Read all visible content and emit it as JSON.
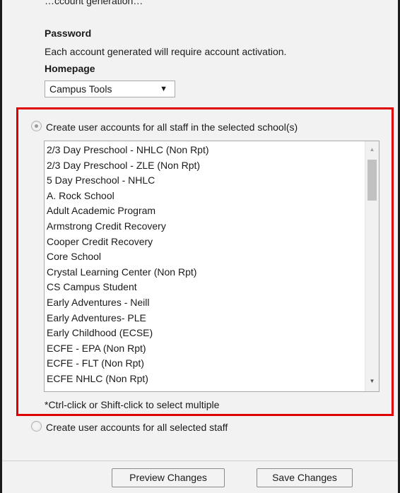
{
  "partial_top_text": "…ccount generation…",
  "password": {
    "label": "Password",
    "note": "Each account generated will require account activation."
  },
  "homepage": {
    "label": "Homepage",
    "selected": "Campus Tools",
    "arrow": "▼"
  },
  "option_school": {
    "label": "Create user accounts for all staff in the selected school(s)",
    "selected": true
  },
  "schools": [
    "2/3 Day Preschool - NHLC (Non Rpt)",
    "2/3 Day Preschool - ZLE (Non Rpt)",
    "5 Day Preschool - NHLC",
    "A. Rock School",
    "Adult Academic Program",
    "Armstrong Credit Recovery",
    "Cooper Credit Recovery",
    "Core School",
    "Crystal Learning Center (Non Rpt)",
    "CS Campus Student",
    "Early Adventures - Neill",
    "Early Adventures- PLE",
    "Early Childhood (ECSE)",
    "ECFE - EPA (Non Rpt)",
    "ECFE - FLT (Non Rpt)",
    "ECFE NHLC (Non Rpt)"
  ],
  "scroll": {
    "up": "▲",
    "down": "▼"
  },
  "multi_select_hint": "*Ctrl-click or Shift-click to select multiple",
  "option_staff": {
    "label": "Create user accounts for all selected staff",
    "selected": false
  },
  "buttons": {
    "preview": "Preview Changes",
    "save": "Save Changes"
  },
  "colors": {
    "highlight_border": "#e00000",
    "panel_background": "#f2f2f2"
  }
}
